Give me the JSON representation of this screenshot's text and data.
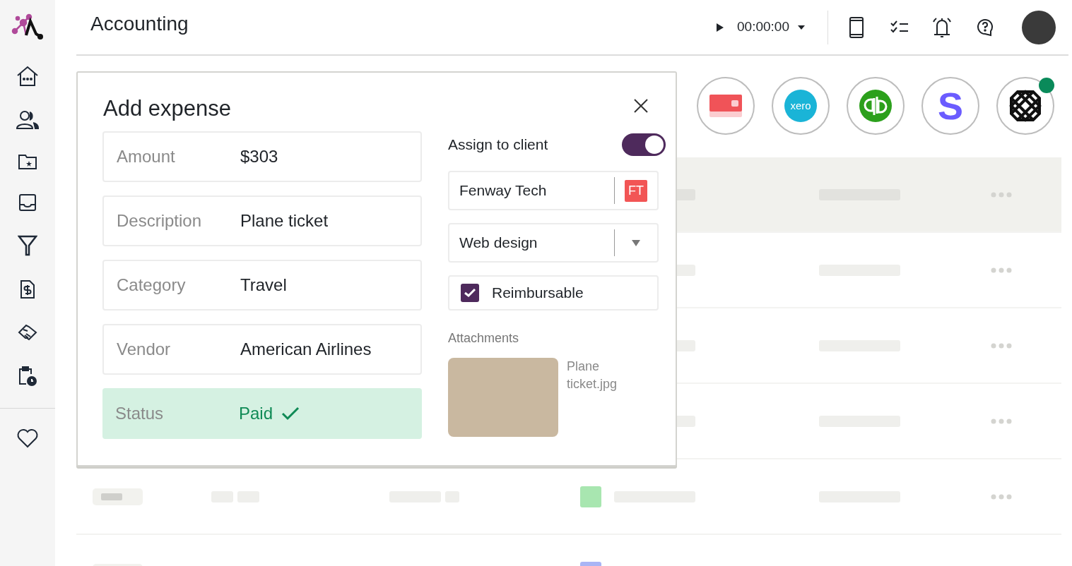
{
  "header": {
    "title": "Accounting",
    "timer": "00:00:00"
  },
  "integrations": [
    {
      "kind": "card",
      "connected": false
    },
    {
      "kind": "xero",
      "label": "xero",
      "connected": false
    },
    {
      "kind": "qb",
      "connected": false
    },
    {
      "kind": "s",
      "label": "S",
      "connected": false
    },
    {
      "kind": "grid",
      "connected": true
    }
  ],
  "rows": [
    {
      "selected": true
    },
    {
      "selected": false
    },
    {
      "selected": false
    },
    {
      "selected": false
    },
    {
      "selected": false,
      "color": "#a8e6b0"
    },
    {
      "selected": false,
      "color": "#a9b5f5"
    }
  ],
  "dialog": {
    "title": "Add expense",
    "fields": [
      {
        "kind": "text",
        "label": "Amount",
        "value": "$303"
      },
      {
        "kind": "text",
        "label": "Description",
        "value": "Plane ticket"
      },
      {
        "kind": "text",
        "label": "Category",
        "value": "Travel"
      },
      {
        "kind": "text",
        "label": "Vendor",
        "value": "American Airlines"
      },
      {
        "kind": "status",
        "label": "Status",
        "value": "Paid"
      }
    ],
    "assign_to_client": {
      "label": "Assign to client",
      "on": true
    },
    "client": {
      "value": "Fenway Tech",
      "badge": "FT"
    },
    "project": {
      "value": "Web design"
    },
    "reimbursable": {
      "label": "Reimbursable",
      "checked": true
    },
    "attachments": {
      "label": "Attachments",
      "files": [
        {
          "name": "Plane ticket.jpg"
        }
      ]
    }
  }
}
